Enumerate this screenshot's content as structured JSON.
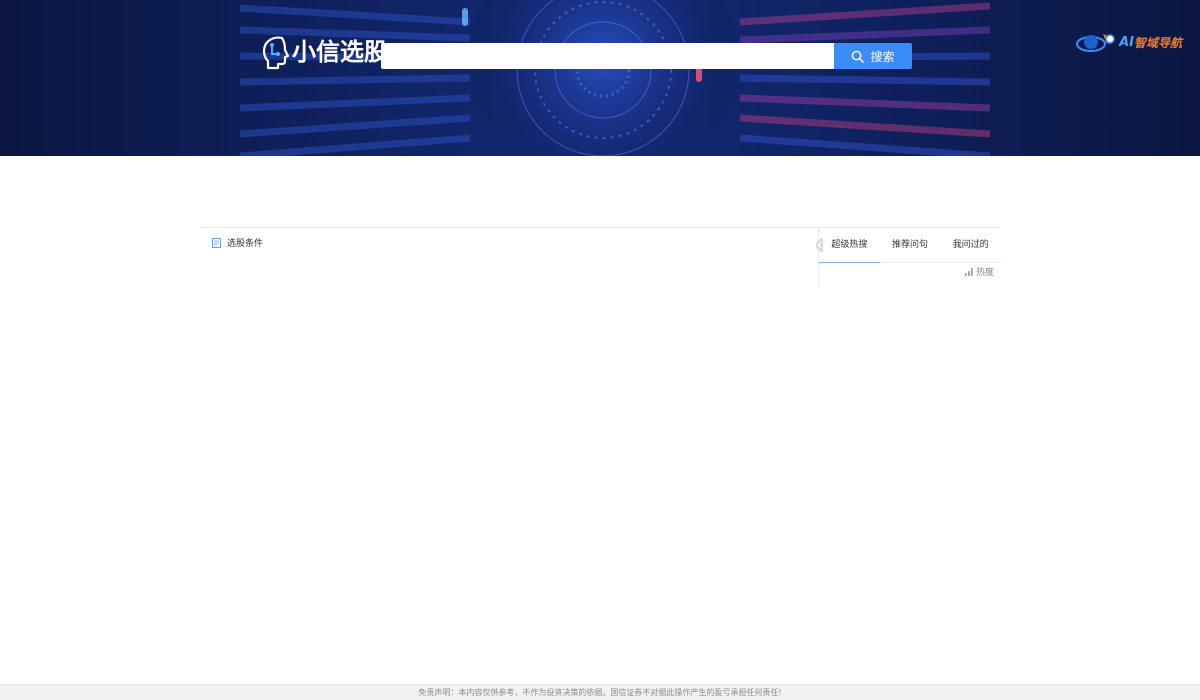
{
  "header": {
    "logo_text": "小信选股",
    "search": {
      "value": "",
      "placeholder": "",
      "button_label": "搜索"
    },
    "nav_logo": {
      "ai_text": "AI",
      "rest_text": "智域导航"
    }
  },
  "main": {
    "left_panel": {
      "title": "选股条件"
    },
    "right_panel": {
      "tabs": [
        {
          "label": "超级热搜",
          "active": true
        },
        {
          "label": "推荐问句",
          "active": false
        },
        {
          "label": "我问过的",
          "active": false
        }
      ],
      "heat_label": "热度"
    }
  },
  "footer": {
    "disclaimer": "免责声明：本内容仅供参考，不作为投资决策的依据。国信证券不对据此操作产生的盈亏承担任何责任!"
  },
  "colors": {
    "banner_bg": "#0b1a4a",
    "accent_blue": "#3c8cf7",
    "tab_underline": "#7fb6ef",
    "nav_orange": "#f07a2a"
  }
}
